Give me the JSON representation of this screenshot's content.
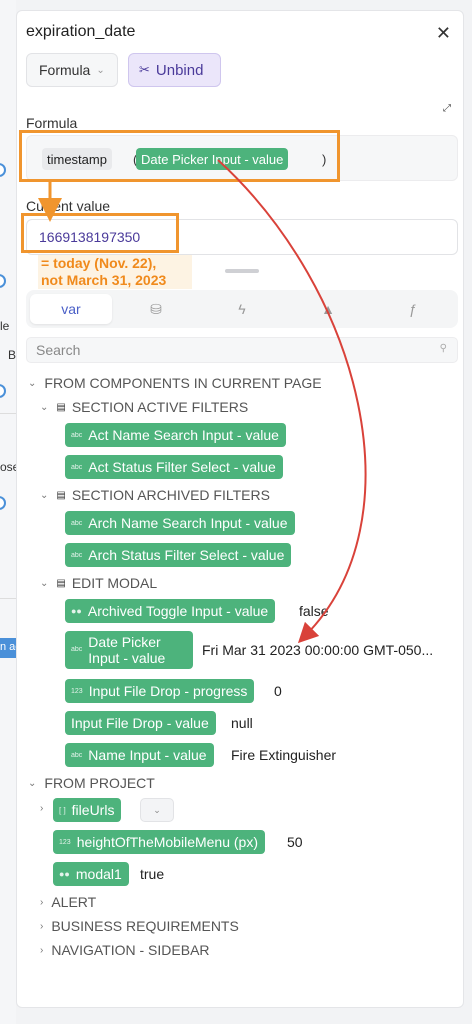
{
  "background": {
    "left_text_1": "le",
    "left_text_2": "B",
    "left_text_3": "ose",
    "left_button": "n ac"
  },
  "panel": {
    "title": "expiration_date",
    "close_icon": "close-icon",
    "mode_select": "Formula",
    "unbind_label": "Unbind",
    "formula_label": "Formula",
    "current_value_label": "Current value"
  },
  "formula": {
    "fn": "timestamp",
    "open": "(",
    "arg": "Date Picker Input - value",
    "close": ")"
  },
  "current_value": "1669138197350",
  "annotation": {
    "line1": "= today (Nov. 22),",
    "line2": "not March 31, 2023"
  },
  "tabs": [
    {
      "label": "var",
      "icon": "variable-icon"
    },
    {
      "label": "",
      "icon": "database-icon"
    },
    {
      "label": "",
      "icon": "lightning-icon"
    },
    {
      "label": "",
      "icon": "mountain-icon"
    },
    {
      "label": "ƒ",
      "icon": "function-icon"
    }
  ],
  "search": {
    "placeholder": "Search"
  },
  "groups": {
    "components": "FROM COMPONENTS IN CURRENT PAGE",
    "active_filters": "SECTION ACTIVE FILTERS",
    "archived_filters": "SECTION ARCHIVED FILTERS",
    "edit_modal": "EDIT MODAL",
    "project": "FROM PROJECT",
    "alert": "ALERT",
    "business": "BUSINESS REQUIREMENTS",
    "navigation": "NAVIGATION - SIDEBAR"
  },
  "type_tags": {
    "abc": "abc",
    "num": "123",
    "list": "[ ]"
  },
  "variables": {
    "act_name": "Act Name Search Input - value",
    "act_status": "Act Status Filter Select - value",
    "arch_name": "Arch Name Search Input - value",
    "arch_status": "Arch Status Filter Select - value",
    "archived_toggle": {
      "label": "Archived Toggle Input - value",
      "value": "false"
    },
    "date_picker": {
      "line1": "Date Picker",
      "line2": "Input - value",
      "value": "Fri Mar 31 2023 00:00:00 GMT-050..."
    },
    "file_progress": {
      "label": "Input File Drop - progress",
      "value": "0"
    },
    "file_value": {
      "label": "Input File Drop - value",
      "value": "null"
    },
    "name_input": {
      "label": "Name Input - value",
      "value": "Fire Extinguisher"
    },
    "file_urls": {
      "label": "fileUrls"
    },
    "height_menu": {
      "label": "heightOfTheMobileMenu (px)",
      "value": "50"
    },
    "modal1": {
      "label": "modal1",
      "value": "true"
    }
  },
  "colors": {
    "accent_green": "#4db37c",
    "annotation_orange": "#f0952e",
    "arrow_red": "#d9423a",
    "purple_text": "#4a3a9a"
  }
}
